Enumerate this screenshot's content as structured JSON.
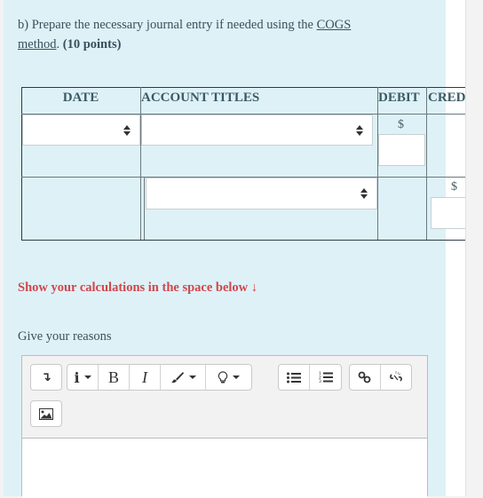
{
  "question": {
    "prefix": "b) Prepare the necessary journal entry if needed using the ",
    "link_part1": "COGS",
    "link_part2": "method",
    "suffix": ".",
    "points": "(10 points)"
  },
  "journal_table": {
    "headers": [
      "DATE",
      "ACCOUNT TITLES",
      "DEBIT",
      "CREDIT"
    ],
    "rows": [
      {
        "date": "",
        "account": "",
        "debit_currency": "$",
        "debit": "",
        "credit": ""
      },
      {
        "date": "",
        "account": "",
        "debit": "",
        "credit_currency": "$",
        "credit": ""
      }
    ]
  },
  "calc_note": "Show your calculations in the space below ↓",
  "reasons_label": "Give your reasons",
  "editor": {
    "toolbar": [
      {
        "name": "show-more-icon",
        "glyph": "↴"
      },
      {
        "name": "paragraph-style-icon",
        "glyph": "i"
      },
      {
        "name": "bold-icon",
        "glyph": "B"
      },
      {
        "name": "italic-icon",
        "glyph": "I"
      },
      {
        "name": "text-color-icon",
        "glyph": "brush"
      },
      {
        "name": "background-color-icon",
        "glyph": "bulb"
      },
      {
        "name": "unordered-list-icon",
        "glyph": "ul"
      },
      {
        "name": "ordered-list-icon",
        "glyph": "ol"
      },
      {
        "name": "link-icon",
        "glyph": "link"
      },
      {
        "name": "unlink-icon",
        "glyph": "unlink"
      },
      {
        "name": "image-icon",
        "glyph": "image"
      }
    ],
    "content": ""
  }
}
